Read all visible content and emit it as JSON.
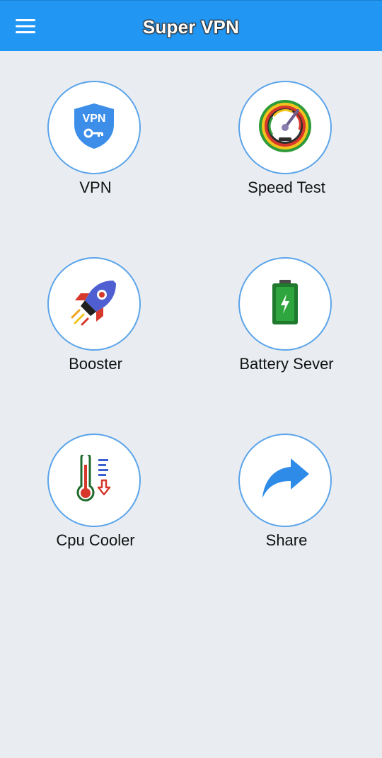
{
  "app": {
    "title": "Super VPN"
  },
  "toolbar": {
    "menu_icon": "hamburger-menu-icon"
  },
  "features": [
    {
      "label": "VPN",
      "icon": "vpn-shield-key-icon"
    },
    {
      "label": "Speed Test",
      "icon": "speedometer-icon"
    },
    {
      "label": "Booster",
      "icon": "rocket-icon"
    },
    {
      "label": "Battery Sever",
      "icon": "battery-charging-icon"
    },
    {
      "label": "Cpu Cooler",
      "icon": "thermometer-icon"
    },
    {
      "label": "Share",
      "icon": "share-arrow-icon"
    }
  ],
  "colors": {
    "appbar": "#2196f3",
    "background": "#e9edf1",
    "circle_border": "#5ba4ea"
  }
}
